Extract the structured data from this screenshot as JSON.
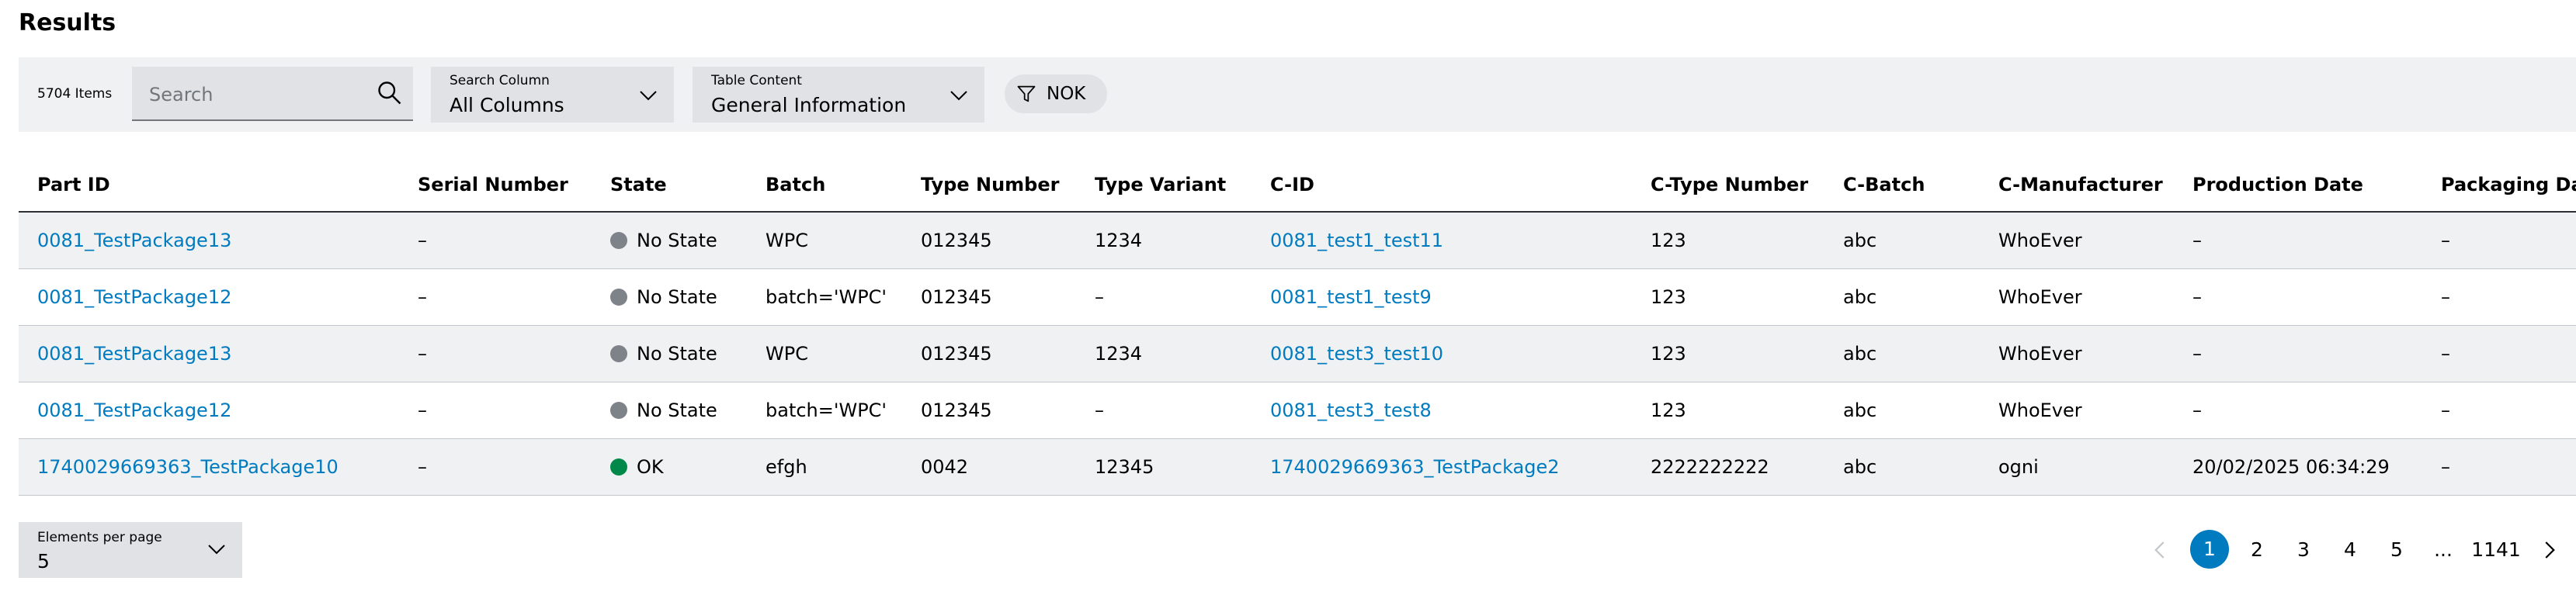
{
  "title": "Results",
  "toolbar": {
    "item_count": "5704 Items",
    "search_placeholder": "Search",
    "search_column": {
      "label": "Search Column",
      "value": "All Columns"
    },
    "table_content": {
      "label": "Table Content",
      "value": "General Information"
    },
    "filter_chip": "NOK"
  },
  "table": {
    "columns": [
      "Part ID",
      "Serial Number",
      "State",
      "Batch",
      "Type Number",
      "Type Variant",
      "C-ID",
      "C-Type Number",
      "C-Batch",
      "C-Manufacturer",
      "Production Date",
      "Packaging Da"
    ],
    "rows": [
      {
        "part_id": "0081_TestPackage13",
        "serial": "–",
        "state": "No State",
        "batch": "WPC",
        "type_number": "012345",
        "type_variant": "1234",
        "cid": "0081_test1_test11",
        "c_type": "123",
        "c_batch": "abc",
        "c_manufacturer": "WhoEver",
        "production_date": "–",
        "packaging_date": "–"
      },
      {
        "part_id": "0081_TestPackage12",
        "serial": "–",
        "state": "No State",
        "batch": "batch='WPC'",
        "type_number": "012345",
        "type_variant": "–",
        "cid": "0081_test1_test9",
        "c_type": "123",
        "c_batch": "abc",
        "c_manufacturer": "WhoEver",
        "production_date": "–",
        "packaging_date": "–"
      },
      {
        "part_id": "0081_TestPackage13",
        "serial": "–",
        "state": "No State",
        "batch": "WPC",
        "type_number": "012345",
        "type_variant": "1234",
        "cid": "0081_test3_test10",
        "c_type": "123",
        "c_batch": "abc",
        "c_manufacturer": "WhoEver",
        "production_date": "–",
        "packaging_date": "–"
      },
      {
        "part_id": "0081_TestPackage12",
        "serial": "–",
        "state": "No State",
        "batch": "batch='WPC'",
        "type_number": "012345",
        "type_variant": "–",
        "cid": "0081_test3_test8",
        "c_type": "123",
        "c_batch": "abc",
        "c_manufacturer": "WhoEver",
        "production_date": "–",
        "packaging_date": "–"
      },
      {
        "part_id": "1740029669363_TestPackage10",
        "serial": "–",
        "state": "OK",
        "batch": "efgh",
        "type_number": "0042",
        "type_variant": "12345",
        "cid": "1740029669363_TestPackage2",
        "c_type": "2222222222",
        "c_batch": "abc",
        "c_manufacturer": "ogni",
        "production_date": "20/02/2025 06:34:29",
        "packaging_date": "–"
      }
    ]
  },
  "state_colors": {
    "No State": "#7d8389",
    "OK": "#00884a"
  },
  "footer": {
    "per_page_label": "Elements per page",
    "per_page_value": "5",
    "pagination": {
      "pages": [
        "1",
        "2",
        "3",
        "4",
        "5",
        "...",
        "1141"
      ],
      "current": "1"
    }
  },
  "colors": {
    "accent": "#007bc0",
    "toolbar_bg": "#eff1f2",
    "control_bg": "#e0e2e5"
  }
}
